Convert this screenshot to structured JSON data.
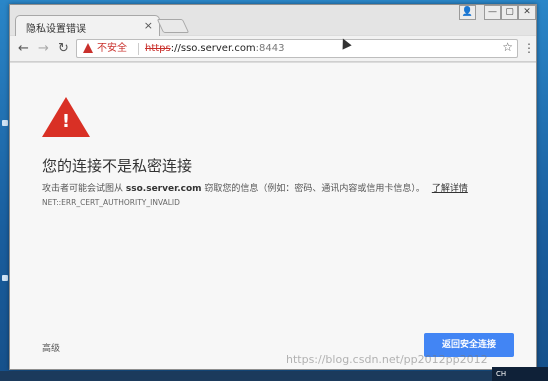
{
  "window": {
    "tab_title": "隐私设置错误",
    "tab_close": "×",
    "controls": {
      "user": "👤",
      "minimize": "—",
      "maximize": "▢",
      "close": "✕"
    }
  },
  "toolbar": {
    "back": "←",
    "forward": "→",
    "reload": "↻",
    "security_label": "不安全",
    "url_scheme": "https",
    "url_host": "://sso.server.com",
    "url_port": ":8443",
    "star": "☆",
    "menu": "⋮"
  },
  "page": {
    "warn_mark": "!",
    "heading": "您的连接不是私密连接",
    "desc_prefix": "攻击者可能会试图从",
    "desc_host": "sso.server.com",
    "desc_suffix": "窃取您的信息（例如：密码、通讯内容或信用卡信息）。",
    "learn_more": "了解详情",
    "error_code": "NET::ERR_CERT_AUTHORITY_INVALID",
    "advanced": "高级",
    "back_to_safety": "返回安全连接"
  },
  "tray": {
    "lang": "CH"
  },
  "watermark": "https://blog.csdn.net/pp2012pp2012"
}
